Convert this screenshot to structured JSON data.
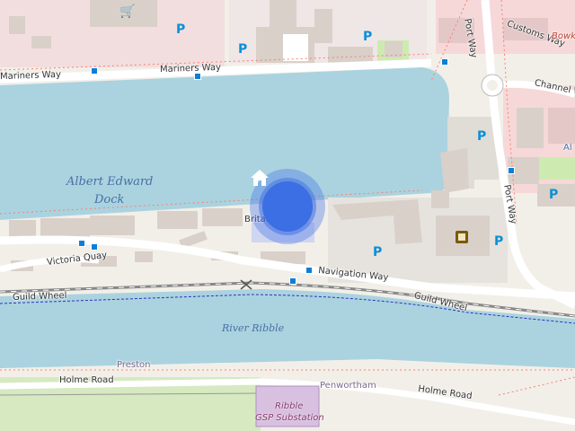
{
  "map": {
    "colors": {
      "water": "#aad3df",
      "land": "#f2efe9",
      "building": "#d9d0c9",
      "road": "#ffffff",
      "retail": "#fbd9d9",
      "grass": "#cdebb0",
      "parking": "#e0e0e0",
      "railway": "#777777",
      "footpath": "#fa8072",
      "marker": "#3b6fe3"
    },
    "water_labels": {
      "dock_line1": "Albert Edward",
      "dock_line2": "Dock",
      "river": "River Ribble"
    },
    "road_labels": {
      "mariners_way": "Mariners Way",
      "port_way_top": "Port Way",
      "port_way_right": "Port Way",
      "customs_way": "Customs Way",
      "channel_way": "Channel Way",
      "britannia": "Britan",
      "victoria_quay": "Victoria Quay",
      "navigation_way": "Navigation Way",
      "guild_wheel_left": "Guild Wheel",
      "guild_wheel_right": "Guild Wheel",
      "holme_road_left": "Holme Road",
      "holme_road_right": "Holme Road"
    },
    "place_labels": {
      "preston": "Preston",
      "penwortham": "Penwortham",
      "bowker": "Bowk",
      "substation_line1": "Ribble",
      "substation_line2": "GSP Substation",
      "partial_right": "Al"
    },
    "icons": {
      "parking": "P",
      "home": "home-icon",
      "cinema": "cinema-icon",
      "shop": "shopping-cart-icon",
      "bus_stop": "bus-stop-icon"
    }
  }
}
